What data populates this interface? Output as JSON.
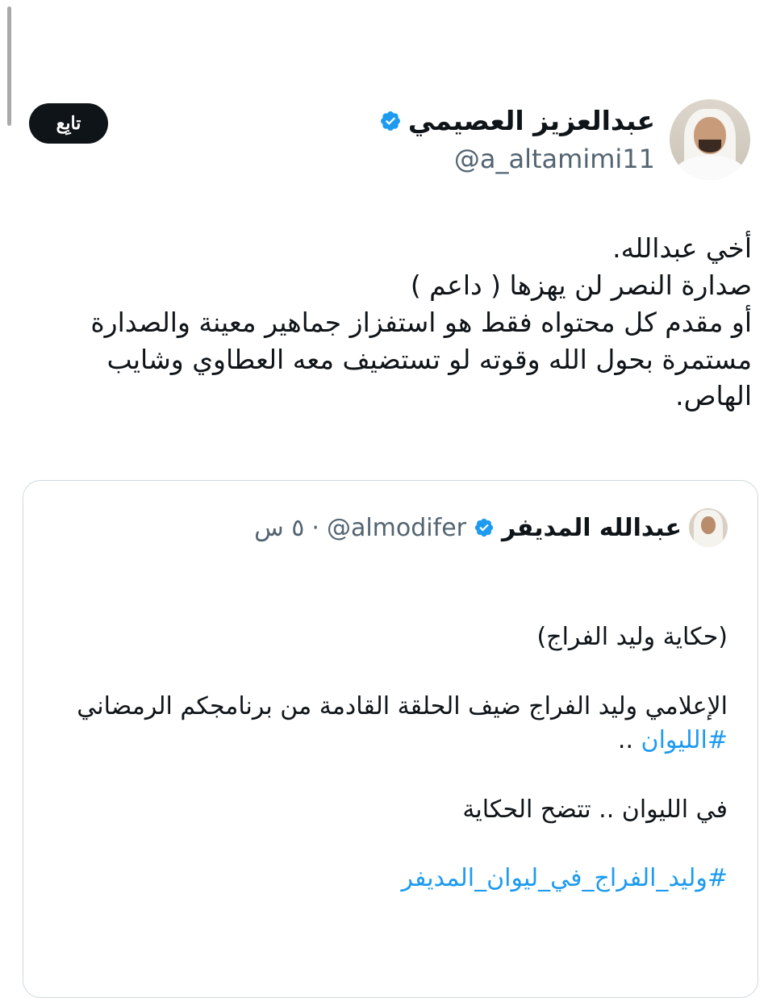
{
  "author": {
    "name": "عبدالعزيز العصيمي",
    "handle": "@a_altamimi11",
    "avatar_icon": "profile-photo"
  },
  "follow_button": {
    "label": "تابِع"
  },
  "tweet": {
    "lines": [
      "أخي عبدالله.",
      "صدارة النصر لن يهزها ( داعم )",
      "أو مقدم كل محتواه فقط هو استفزاز جماهير معينة والصدارة",
      "مستمرة بحول الله وقوته لو تستضيف معه العطاوي وشايب",
      "الهاص."
    ]
  },
  "quoted_tweet": {
    "name": "عبدالله المديفر",
    "handle": "@almodifer",
    "separator": "·",
    "time": "٥ س",
    "paragraph1": "(حكاية وليد الفراج)",
    "paragraph2_line1": "الإعلامي وليد الفراج ضيف الحلقة القادمة من برنامجكم الرمضاني",
    "hashtag1": "#الليوان",
    "hashtag1_suffix": " ..",
    "paragraph3": "في الليوان .. تتضح الحكاية",
    "hashtag2": "#وليد_الفراج_في_ليوان_المديفر"
  },
  "colors": {
    "accent": "#1d9bf0",
    "text": "#0f1419",
    "muted": "#536471",
    "border": "#cfd9de"
  }
}
